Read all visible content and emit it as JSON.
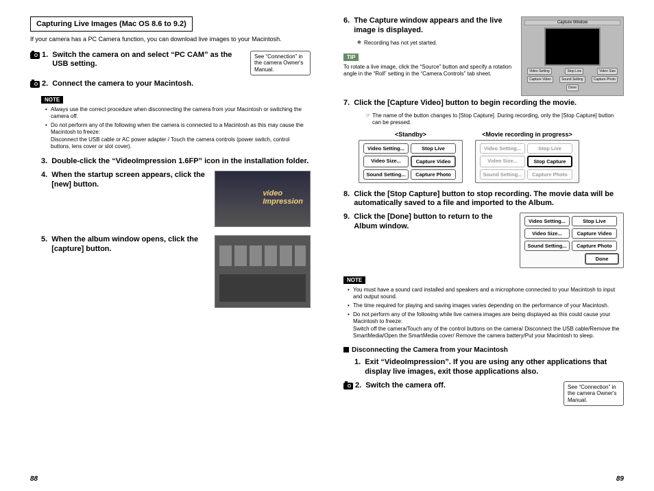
{
  "pageLeft": {
    "number": "88",
    "sectionTitle": "Capturing Live Images (Mac OS 8.6 to 9.2)",
    "intro": "If your camera has a PC Camera function, you can download live images to your Macintosh.",
    "step1": "Switch the camera on and select “PC CAM” as the USB setting.",
    "sideNote1": "See “Connection” in the camera Owner's Manual.",
    "step2": "Connect the camera to your Macintosh.",
    "noteBadge": "NOTE",
    "notes": [
      "Always use the correct procedure when disconnecting the camera from your Macintosh or switching the camera off.",
      "Do not perform any of the following when the camera is connected to a Macintosh as this may cause the Macintosh to freeze:",
      "Disconnect the USB cable or AC power adapter / Touch the camera controls (power switch, control buttons, lens cover or slot cover)."
    ],
    "step3": "Double-click the “VideoImpression 1.6FP” icon in the installation folder.",
    "step4": "When the startup screen appears, click the [new] button.",
    "step5": "When the album window opens, click the [capture] button."
  },
  "pageRight": {
    "number": "89",
    "step6": "The Capture window appears and the live image is displayed.",
    "step6sub": "Recording has not yet started.",
    "tipBadge": "TIP",
    "tipText": "To rotate a live image, click the “Source” button and specify a rotation angle in the “Roll” setting in the “Camera Controls” tab sheet.",
    "step7": "Click the [Capture Video] button to begin recording the movie.",
    "step7sub": "The name of the button changes to [Stop Capture]. During recording, only the [Stop Capture] button can be pressed.",
    "standbyLabel": "<Standby>",
    "recordingLabel": "<Movie recording in progress>",
    "buttons": {
      "vset": "Video Setting...",
      "vsize": "Video Size...",
      "sset": "Sound Setting...",
      "stoplive": "Stop Live",
      "capvid": "Capture Video",
      "capphoto": "Capture Photo",
      "stopcap": "Stop Capture",
      "done": "Done"
    },
    "step8": "Click the [Stop Capture] button to stop recording. The movie data will be automatically saved to a file and imported to the Album.",
    "step9": "Click the [Done] button to return to the Album window.",
    "noteBadge": "NOTE",
    "notes2": [
      "You must have a sound card installed and speakers and a microphone connected to your Macintosh to input and output sound.",
      "The time required for playing and saving images varies depending on the performance of your Macintosh.",
      "Do not perform any of the following while live camera images are being displayed as this could cause your Macintosh to freeze:",
      "Switch off the camera/Touch any of the control buttons on the camera/ Disconnect the USB cable/Remove the SmartMedia/Open the SmartMedia cover/ Remove the camera battery/Put your Macintosh to sleep."
    ],
    "disconnectHead": "Disconnecting the Camera from your Macintosh",
    "dstep1": "Exit “VideoImpression”. If you are using any other applications that display live images, exit those applications also.",
    "dstep2": "Switch the camera off.",
    "sideNote2": "See “Connection” in the camera Owner's Manual."
  }
}
